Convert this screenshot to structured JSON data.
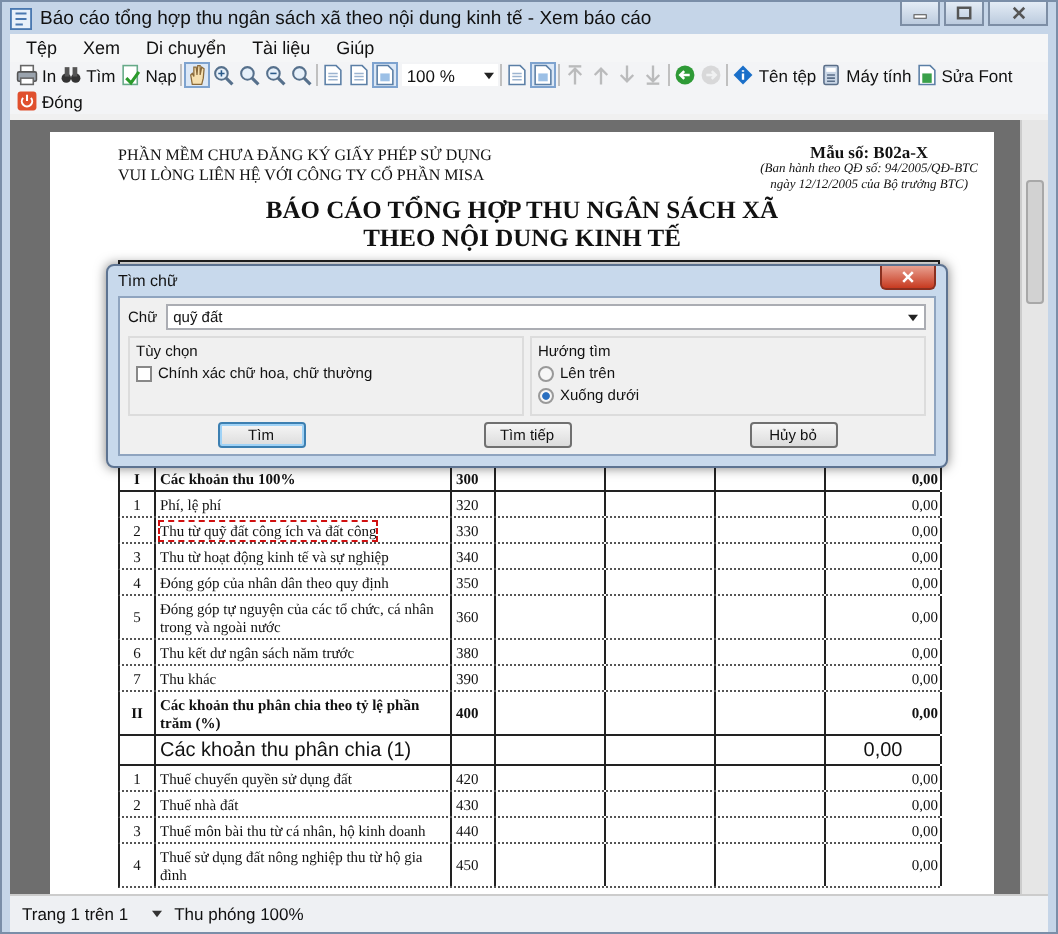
{
  "window": {
    "title": "Báo cáo tổng hợp thu ngân sách xã theo nội dung kinh tế - Xem báo cáo"
  },
  "menu": [
    "Tệp",
    "Xem",
    "Di chuyển",
    "Tài liệu",
    "Giúp"
  ],
  "toolbars": [
    {
      "items": [
        {
          "kind": "button",
          "label": "In",
          "disabled": false,
          "selected": false
        },
        {
          "kind": "button",
          "label": "Tìm",
          "disabled": false,
          "selected": false
        },
        {
          "kind": "button",
          "label": "Nạp",
          "disabled": false,
          "selected": false
        },
        {
          "kind": "separator"
        },
        {
          "kind": "button",
          "disabled": false,
          "selected": true
        },
        {
          "kind": "button",
          "disabled": false,
          "selected": false
        },
        {
          "kind": "button",
          "disabled": false,
          "selected": false
        },
        {
          "kind": "button",
          "disabled": false,
          "selected": false
        },
        {
          "kind": "button",
          "disabled": false,
          "selected": false
        },
        {
          "kind": "separator"
        },
        {
          "kind": "button",
          "disabled": false,
          "selected": false
        },
        {
          "kind": "button",
          "disabled": false,
          "selected": false
        },
        {
          "kind": "button",
          "disabled": false,
          "selected": true
        },
        {
          "kind": "dropdown",
          "value": "100 %"
        },
        {
          "kind": "separator"
        },
        {
          "kind": "button",
          "disabled": false,
          "selected": false
        },
        {
          "kind": "button",
          "disabled": false,
          "selected": true
        },
        {
          "kind": "separator"
        },
        {
          "kind": "button",
          "disabled": true,
          "selected": false
        },
        {
          "kind": "button",
          "disabled": true,
          "selected": false
        },
        {
          "kind": "button",
          "disabled": true,
          "selected": false
        },
        {
          "kind": "button",
          "disabled": true,
          "selected": false
        },
        {
          "kind": "separator"
        },
        {
          "kind": "button",
          "disabled": false,
          "selected": false
        },
        {
          "kind": "button",
          "disabled": true,
          "selected": false
        },
        {
          "kind": "separator"
        },
        {
          "kind": "button",
          "label": "Tên tệp",
          "disabled": false,
          "selected": false
        },
        {
          "kind": "button",
          "label": "Máy tính",
          "disabled": false,
          "selected": false
        },
        {
          "kind": "button",
          "label": "Sửa Font",
          "disabled": false,
          "selected": false
        }
      ]
    },
    {
      "items": [
        {
          "kind": "button",
          "label": "Đóng",
          "disabled": false,
          "selected": false
        }
      ]
    }
  ],
  "report": {
    "notice": [
      "PHẦN MỀM CHƯA ĐĂNG KÝ GIẤY PHÉP SỬ DỤNG",
      "VUI LÒNG LIÊN HỆ VỚI CÔNG TY CỔ PHẦN MISA"
    ],
    "form_code": "Mẫu số: B02a-X",
    "form_note": [
      "(Ban hành theo QĐ số: 94/2005/QĐ-BTC",
      "ngày 12/12/2005 của Bộ trưởng BTC)"
    ],
    "title": [
      "BÁO CÁO TỔNG HỢP THU NGÂN SÁCH XÃ",
      "THEO NỘI DUNG KINH TẾ"
    ],
    "rows": [
      {
        "kind": "section",
        "stt": "I",
        "content": "Các khoản thu 100%",
        "code": "300",
        "total": "0,00",
        "found": false
      },
      {
        "kind": "item",
        "stt": "1",
        "content": "Phí, lệ phí",
        "code": "320",
        "total": "0,00",
        "found": false
      },
      {
        "kind": "item",
        "stt": "2",
        "content": "Thu từ quỹ đất công ích và đất công",
        "code": "330",
        "total": "0,00",
        "found": true
      },
      {
        "kind": "item",
        "stt": "3",
        "content": "Thu từ hoạt động kinh tế và sự nghiệp",
        "code": "340",
        "total": "0,00",
        "found": false
      },
      {
        "kind": "item",
        "stt": "4",
        "content": "Đóng góp của nhân dân theo quy định",
        "code": "350",
        "total": "0,00",
        "found": false
      },
      {
        "kind": "item",
        "stt": "5",
        "content": "Đóng góp tự nguyện của các tổ chức, cá nhân trong và ngoài nước",
        "code": "360",
        "total": "0,00",
        "found": false
      },
      {
        "kind": "item",
        "stt": "6",
        "content": "Thu kết dư ngân sách năm trước",
        "code": "380",
        "total": "0,00",
        "found": false
      },
      {
        "kind": "item",
        "stt": "7",
        "content": "Thu khác",
        "code": "390",
        "total": "0,00",
        "found": false
      },
      {
        "kind": "section",
        "stt": "II",
        "content": "Các khoản thu phân chia theo tỷ lệ phần trăm (%)",
        "code": "400",
        "total": "0,00",
        "found": false
      },
      {
        "kind": "group",
        "content": "Các khoản thu phân chia (1)",
        "total": "0,00",
        "found": false
      },
      {
        "kind": "item",
        "stt": "1",
        "content": "Thuế chuyển quyền sử dụng đất",
        "code": "420",
        "total": "0,00",
        "found": false
      },
      {
        "kind": "item",
        "stt": "2",
        "content": "Thuế nhà đất",
        "code": "430",
        "total": "0,00",
        "found": false
      },
      {
        "kind": "item",
        "stt": "3",
        "content": "Thuế môn bài thu từ cá nhân, hộ kinh doanh",
        "code": "440",
        "total": "0,00",
        "found": false
      },
      {
        "kind": "item",
        "stt": "4",
        "content": "Thuế sử dụng đất nông nghiệp thu từ hộ gia đình",
        "code": "450",
        "total": "0,00",
        "found": false
      }
    ]
  },
  "find_dialog": {
    "title": "Tìm chữ",
    "field_label": "Chữ",
    "value": "quỹ đất",
    "options": {
      "title": "Tùy chọn",
      "checkbox": {
        "label": "Chính xác chữ hoa, chữ thường",
        "checked": false
      }
    },
    "direction": {
      "title": "Hướng tìm",
      "radios": [
        {
          "label": "Lên trên",
          "selected": false
        },
        {
          "label": "Xuống dưới",
          "selected": true
        }
      ]
    },
    "buttons": [
      {
        "label": "Tìm",
        "default": true
      },
      {
        "label": "Tìm tiếp",
        "default": false
      },
      {
        "label": "Hủy bỏ",
        "default": false
      }
    ]
  },
  "status_bar": {
    "page": "Trang 1 trên 1",
    "zoom": "Thu phóng 100%"
  }
}
